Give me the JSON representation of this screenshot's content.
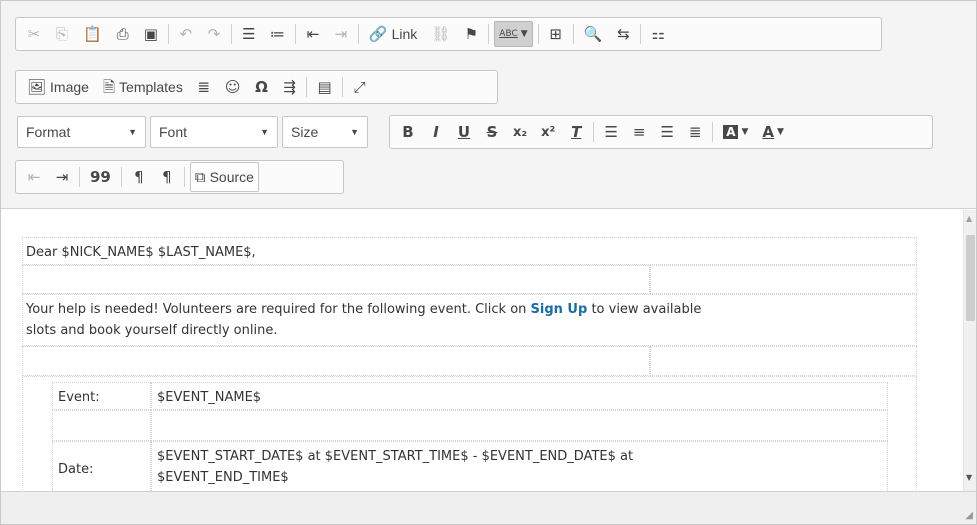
{
  "toolbar": {
    "link_label": "Link",
    "image_label": "Image",
    "templates_label": "Templates",
    "source_label": "Source",
    "format_combo": "Format",
    "font_combo": "Font",
    "size_combo": "Size",
    "spellcheck_label": "ABC",
    "omega": "Ω",
    "quote": "99",
    "subscript": "x₂",
    "superscript": "x²"
  },
  "content": {
    "greeting": "Dear $NICK_NAME$ $LAST_NAME$,",
    "intro_before": "Your help is needed! Volunteers are required for the following event. Click on ",
    "intro_link": "Sign Up",
    "intro_after_line1": " to view available",
    "intro_line2": "slots and book yourself directly online.",
    "event_label": "Event:",
    "event_value": "$EVENT_NAME$",
    "date_label": "Date:",
    "date_value_line1": "$EVENT_START_DATE$ at $EVENT_START_TIME$ - $EVENT_END_DATE$ at",
    "date_value_line2": "$EVENT_END_TIME$"
  },
  "colors": {
    "link_color": "#1a6ea1",
    "toolbar_bg": "#f4f4f4"
  }
}
